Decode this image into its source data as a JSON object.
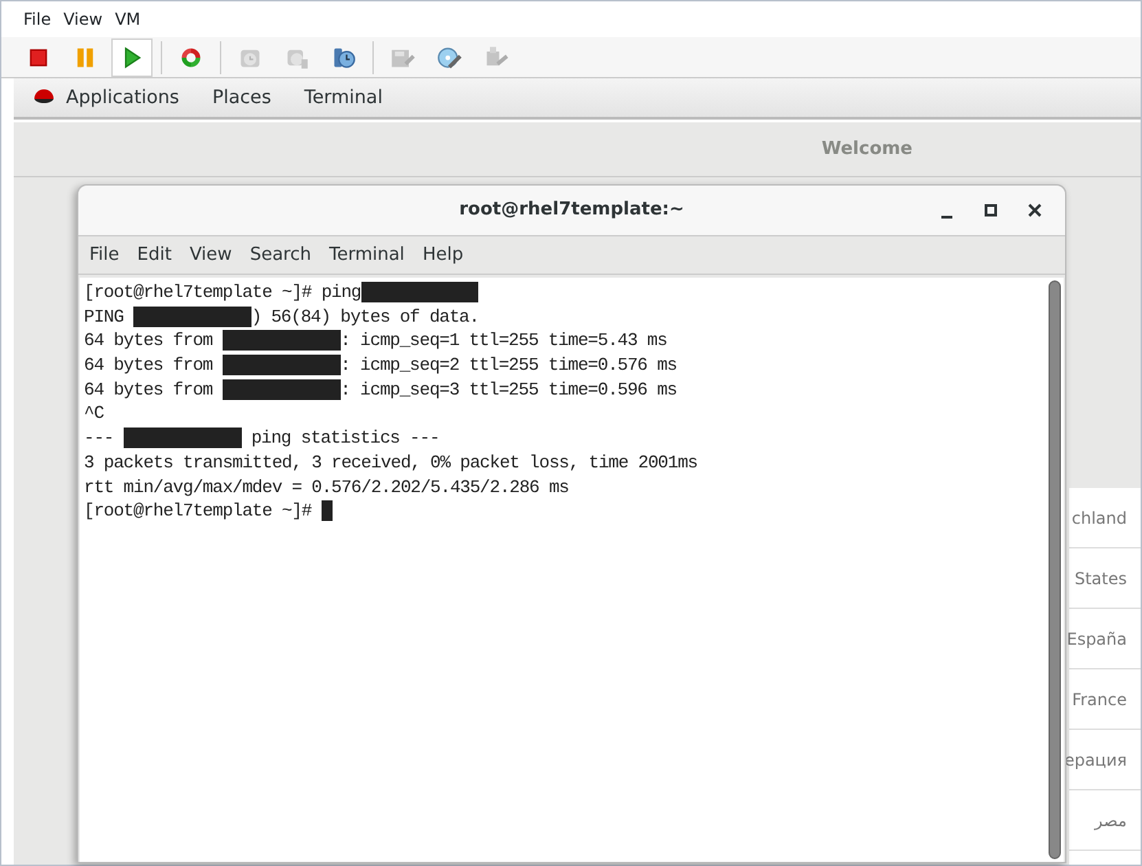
{
  "vm_menu": [
    "File",
    "View",
    "VM"
  ],
  "toolbar": [
    {
      "kind": "stop",
      "disabled": false,
      "selected": false
    },
    {
      "kind": "pause",
      "disabled": false,
      "selected": false
    },
    {
      "kind": "play",
      "disabled": false,
      "selected": true
    },
    {
      "kind": "reset",
      "disabled": false,
      "selected": false
    },
    {
      "kind": "snapshot",
      "disabled": true,
      "selected": false
    },
    {
      "kind": "snapshot-revert",
      "disabled": true,
      "selected": false
    },
    {
      "kind": "snapshot-manager",
      "disabled": false,
      "selected": false
    },
    {
      "kind": "floppy",
      "disabled": true,
      "selected": false
    },
    {
      "kind": "disc",
      "disabled": false,
      "selected": false
    },
    {
      "kind": "usb",
      "disabled": true,
      "selected": false
    }
  ],
  "top_bar": [
    "Applications",
    "Places",
    "Terminal"
  ],
  "welcome_title": "Welcome",
  "languages": [
    "chland",
    "States",
    "España",
    "France",
    "ерация",
    "مصر"
  ],
  "terminal": {
    "title": "root@rhel7template:~",
    "menu": [
      "File",
      "Edit",
      "View",
      "Search",
      "Terminal",
      "Help"
    ],
    "lines": [
      [
        {
          "kind": "text",
          "text": "[root@rhel7template ~]# ping"
        },
        {
          "kind": "redacted"
        }
      ],
      [
        {
          "kind": "text",
          "text": "PING "
        },
        {
          "kind": "redacted"
        },
        {
          "kind": "text",
          "text": ") 56(84) bytes of data."
        }
      ],
      [
        {
          "kind": "text",
          "text": "64 bytes from "
        },
        {
          "kind": "redacted"
        },
        {
          "kind": "text",
          "text": ": icmp_seq=1 ttl=255 time=5.43 ms"
        }
      ],
      [
        {
          "kind": "text",
          "text": "64 bytes from "
        },
        {
          "kind": "redacted"
        },
        {
          "kind": "text",
          "text": ": icmp_seq=2 ttl=255 time=0.576 ms"
        }
      ],
      [
        {
          "kind": "text",
          "text": "64 bytes from "
        },
        {
          "kind": "redacted"
        },
        {
          "kind": "text",
          "text": ": icmp_seq=3 ttl=255 time=0.596 ms"
        }
      ],
      [
        {
          "kind": "text",
          "text": "^C"
        }
      ],
      [
        {
          "kind": "text",
          "text": "--- "
        },
        {
          "kind": "redacted"
        },
        {
          "kind": "text",
          "text": " ping statistics ---"
        }
      ],
      [
        {
          "kind": "text",
          "text": "3 packets transmitted, 3 received, 0% packet loss, time 2001ms"
        }
      ],
      [
        {
          "kind": "text",
          "text": "rtt min/avg/max/mdev = 0.576/2.202/5.435/2.286 ms"
        }
      ],
      [
        {
          "kind": "text",
          "text": "[root@rhel7template ~]# "
        },
        {
          "kind": "cursor"
        }
      ]
    ]
  }
}
